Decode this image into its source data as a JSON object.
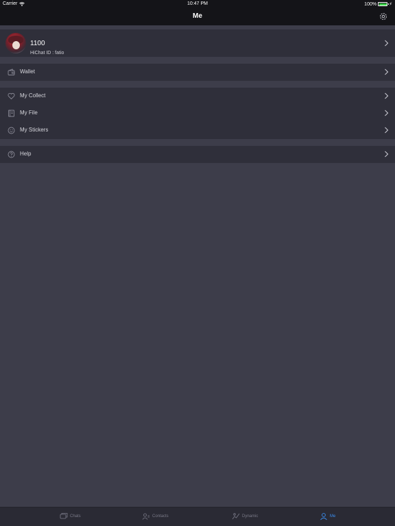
{
  "status_bar": {
    "carrier": "Carrier",
    "time": "10:47 PM",
    "battery": "100%"
  },
  "header": {
    "title": "Me"
  },
  "profile": {
    "name": "1100",
    "hichat_id": "HiChat ID : fatio"
  },
  "menu": {
    "wallet": "Wallet",
    "my_collect": "My Collect",
    "my_file": "My File",
    "my_stickers": "My Stickers",
    "help": "Help"
  },
  "tabs": [
    {
      "label": "Chats",
      "icon": "chats-icon"
    },
    {
      "label": "Contacts",
      "icon": "contacts-icon"
    },
    {
      "label": "Dynamic",
      "icon": "dynamic-icon"
    },
    {
      "label": "Me",
      "icon": "me-icon",
      "active": true
    }
  ],
  "colors": {
    "accent": "#3b8ef0",
    "background": "#3d3d4a",
    "group": "#2f2f3a",
    "bar": "#141418"
  }
}
